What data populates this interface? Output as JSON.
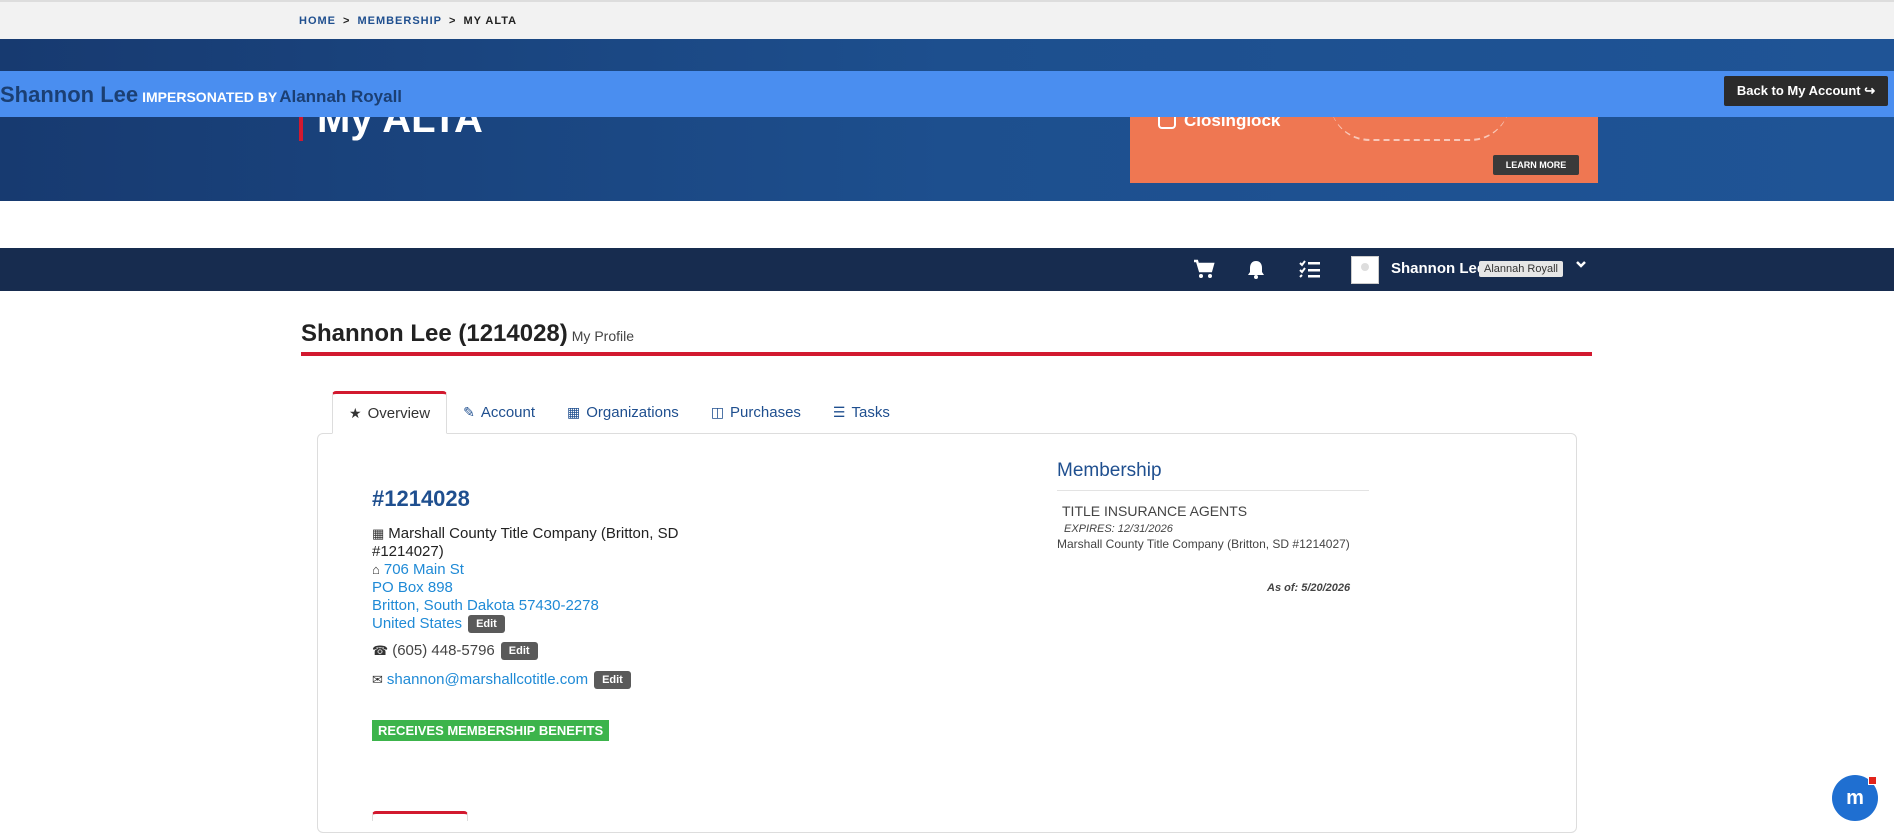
{
  "breadcrumb": {
    "home": "HOME",
    "membership": "MEMBERSHIP",
    "current": "MY ALTA",
    "sep": ">"
  },
  "hero": {
    "title": "My ALTA"
  },
  "ad": {
    "brand": "Closinglock",
    "cta": "LEARN MORE"
  },
  "impersonation": {
    "user": "Shannon Lee",
    "label": "IMPERSONATED BY",
    "by": "Alannah Royall",
    "back_button": "Back to My Account"
  },
  "navbar": {
    "user_name": "Shannon Lee",
    "impersonator_badge": "Alannah Royall",
    "icons": [
      "cart-icon",
      "bell-icon",
      "tasks-icon",
      "avatar",
      "chevron-down-icon"
    ]
  },
  "profile": {
    "title": "Shannon Lee (1214028)",
    "subtitle": "My Profile"
  },
  "tabs": [
    {
      "label": "Overview",
      "icon": "star-icon",
      "active": true
    },
    {
      "label": "Account",
      "icon": "edit-icon"
    },
    {
      "label": "Organizations",
      "icon": "building-icon"
    },
    {
      "label": "Purchases",
      "icon": "cart-icon"
    },
    {
      "label": "Tasks",
      "icon": "tasks-icon"
    }
  ],
  "overview": {
    "member_id": "#1214028",
    "org_line1": "Marshall County Title Company (Britton, SD",
    "org_line2": "#1214027)",
    "address_line1": "706 Main St",
    "address_line2": "PO Box 898",
    "address_line3": "Britton, South Dakota 57430-2278",
    "address_line4": "United States",
    "phone": "(605) 448-5796",
    "email": "shannon@marshallcotitle.com",
    "edit_label": "Edit",
    "benefits_badge": "RECEIVES MEMBERSHIP BENEFITS"
  },
  "membership": {
    "heading": "Membership",
    "type": "TITLE INSURANCE AGENTS",
    "expires": "EXPIRES: 12/31/2026",
    "org": "Marshall County Title Company (Britton, SD #1214027)",
    "as_of": "As of: 5/20/2026"
  },
  "chat": {
    "icon": "chat-icon",
    "glyph": "m"
  }
}
